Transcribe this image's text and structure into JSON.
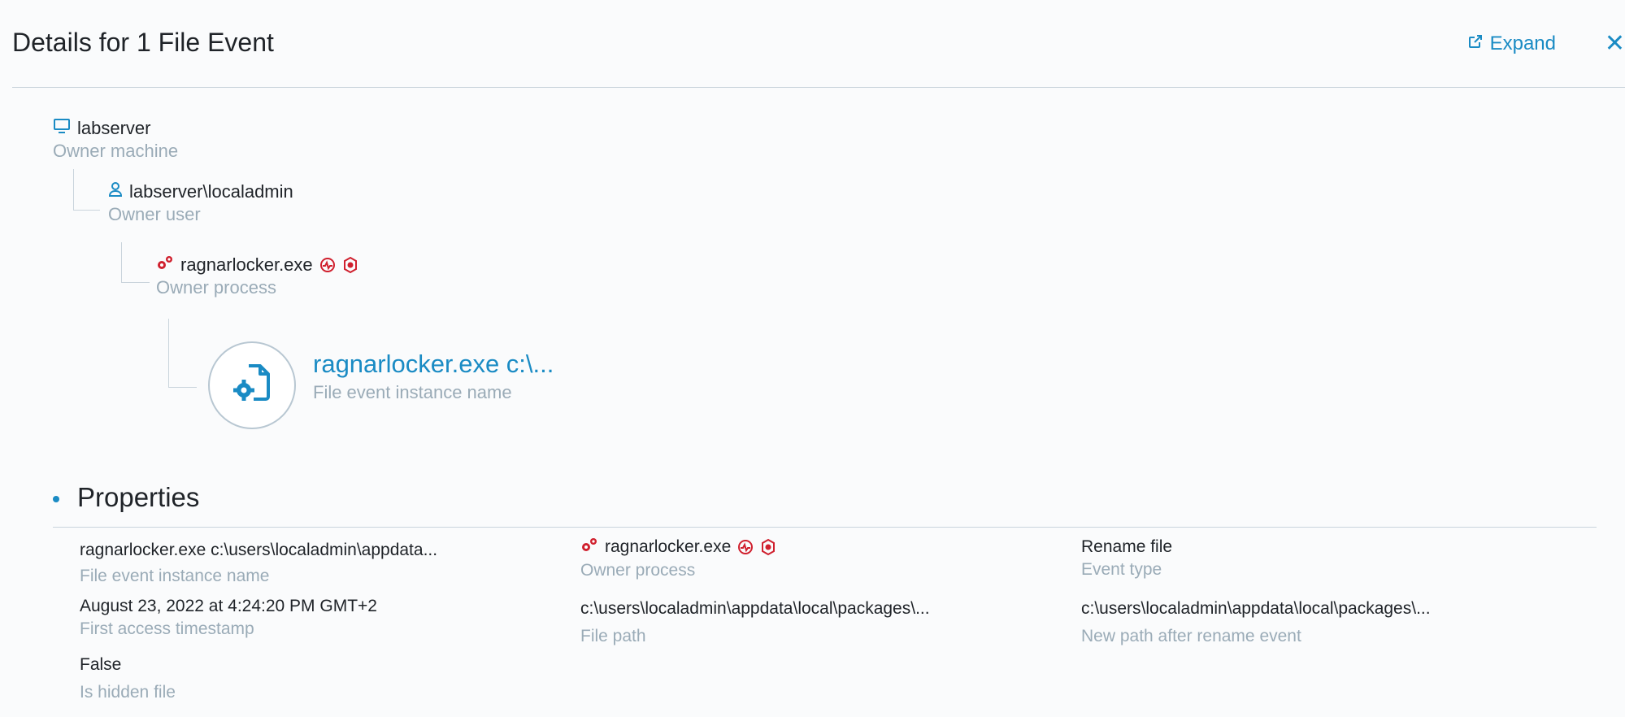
{
  "header": {
    "title": "Details for 1 File Event",
    "expand_label": "Expand",
    "close_symbol": "✕"
  },
  "tree": {
    "machine": {
      "name": "labserver",
      "label": "Owner machine",
      "icon": "monitor-icon"
    },
    "user": {
      "name": "labserver\\localadmin",
      "label": "Owner user",
      "icon": "user-icon"
    },
    "process": {
      "name": "ragnarlocker.exe",
      "label": "Owner process",
      "icon": "gears-icon"
    },
    "instance": {
      "name": "ragnarlocker.exe c:\\...",
      "label": "File event instance name",
      "icon": "file-gear-icon"
    }
  },
  "properties": {
    "title": "Properties",
    "items": [
      {
        "value": "ragnarlocker.exe c:\\users\\localadmin\\appdata...",
        "label": "File event instance name"
      },
      {
        "value": "August 23, 2022 at 4:24:20 PM GMT+2",
        "label": "First access timestamp"
      },
      {
        "value": "False",
        "label": "Is hidden file"
      },
      {
        "value": "ragnarlocker.exe",
        "label": "Owner process"
      },
      {
        "value": "c:\\users\\localadmin\\appdata\\local\\packages\\...",
        "label": "File path"
      },
      {
        "value": "Rename file",
        "label": "Event type"
      },
      {
        "value": "c:\\users\\localadmin\\appdata\\local\\packages\\...",
        "label": "New path after rename event"
      }
    ]
  },
  "colors": {
    "accent": "#1a8bc4",
    "alert": "#d0202e",
    "muted": "#9aabb7",
    "line": "#c9d4dc"
  }
}
